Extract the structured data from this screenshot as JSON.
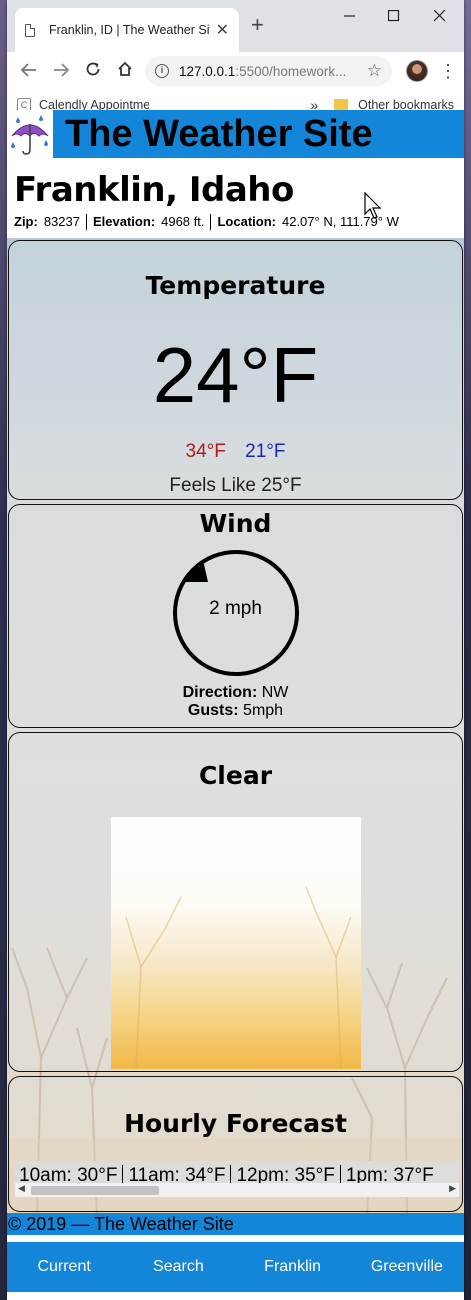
{
  "browser": {
    "tab_title": "Franklin, ID | The Weather Site",
    "tab_close": "✕",
    "new_tab": "+",
    "url_host": "127.0.0.1",
    "url_path": ":5500/homework...",
    "bookmarks": [
      {
        "label": "Calendly Appointmen",
        "icon": "calendly-icon"
      },
      {
        "label": "Other bookmarks",
        "icon": "folder-icon"
      }
    ],
    "bookmarks_overflow": "»"
  },
  "site": {
    "title": "The Weather Site",
    "logo_icon": "umbrella-rain-icon"
  },
  "location": {
    "name": "Franklin, Idaho",
    "zip_label": "Zip:",
    "zip": "83237",
    "elevation_label": "Elevation:",
    "elevation": "4968 ft.",
    "location_label": "Location:",
    "coords": "42.07° N, 111.79° W"
  },
  "temperature": {
    "title": "Temperature",
    "current": "24°F",
    "high": "34°F",
    "low": "21°F",
    "feels_like": "Feels Like 25°F",
    "high_color": "#b01c1c",
    "low_color": "#1c28b0"
  },
  "wind": {
    "title": "Wind",
    "speed": "2 mph",
    "direction_label": "Direction:",
    "direction": "NW",
    "gusts_label": "Gusts:",
    "gusts": "5mph"
  },
  "condition": {
    "title": "Clear"
  },
  "hourly": {
    "title": "Hourly Forecast",
    "items": [
      "10am: 30°F",
      "11am: 34°F",
      "12pm: 35°F",
      "1pm: 37°F"
    ]
  },
  "footer": {
    "copyright": "© 2019 — The Weather Site"
  },
  "nav": [
    "Current",
    "Search",
    "Franklin",
    "Greenville"
  ],
  "colors": {
    "brand_blue": "#1486d9"
  }
}
